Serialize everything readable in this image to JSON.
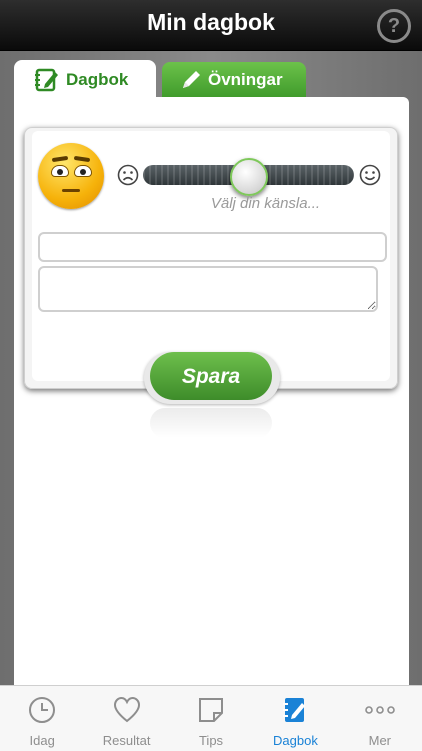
{
  "navbar": {
    "title": "Min dagbok",
    "help_icon": "question-circle-icon",
    "help_glyph": "?"
  },
  "tabs": [
    {
      "label": "Dagbok",
      "icon": "notebook-pencil-icon",
      "active": true
    },
    {
      "label": "Övningar",
      "icon": "pencil-icon",
      "active": false
    }
  ],
  "entry": {
    "mood_emoji": "unamused-face-icon",
    "slider": {
      "hint": "Välj din känsla...",
      "min_icon": "frowning-face-icon",
      "max_icon": "smiling-face-icon",
      "value": 0.5
    },
    "title_input": {
      "value": "",
      "placeholder": ""
    },
    "text_input": {
      "value": "",
      "placeholder": ""
    },
    "save_label": "Spara"
  },
  "tabbar": {
    "items": [
      {
        "label": "Idag",
        "icon": "clock-icon"
      },
      {
        "label": "Resultat",
        "icon": "heart-icon"
      },
      {
        "label": "Tips",
        "icon": "note-icon"
      },
      {
        "label": "Dagbok",
        "icon": "diary-icon"
      },
      {
        "label": "Mer",
        "icon": "more-dots-icon"
      }
    ],
    "active_index": 3,
    "active_color": "#1a82d6",
    "inactive_color": "#8e8e8e"
  },
  "colors": {
    "brand_green": "#3f9a2b",
    "nav_bg": "#111111"
  }
}
